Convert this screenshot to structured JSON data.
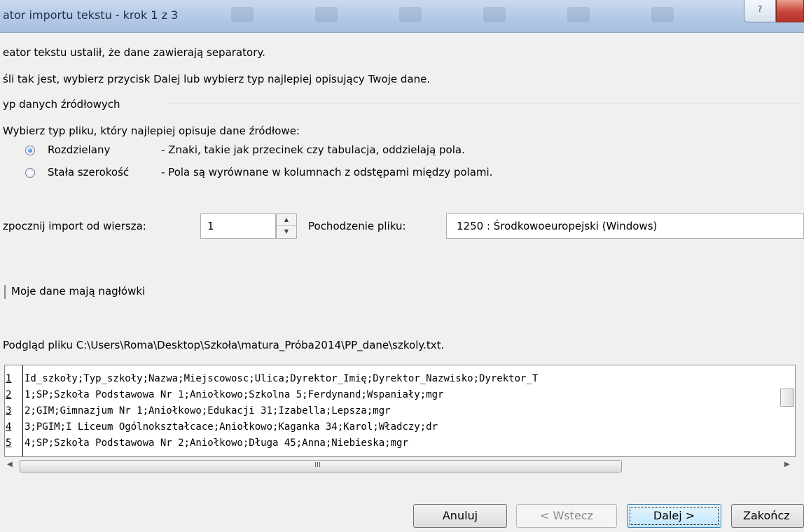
{
  "window": {
    "title": "ator importu tekstu - krok 1 z 3",
    "help_label": "?"
  },
  "intro": {
    "line1": "eator tekstu ustalił, że dane zawierają separatory.",
    "line2": "śli tak jest, wybierz przycisk Dalej lub wybierz typ najlepiej opisujący Twoje dane."
  },
  "group": {
    "title": "yp danych źródłowych",
    "prompt": "Wybierz typ pliku, który najlepiej opisuje dane źródłowe:",
    "options": [
      {
        "label": "Rozdzielany",
        "desc": "- Znaki, takie jak przecinek czy tabulacja, oddzielają pola.",
        "selected": true
      },
      {
        "label": "Stała szerokość",
        "desc": "- Pola są wyrównane w kolumnach z odstępami między polami.",
        "selected": false
      }
    ]
  },
  "import_row": {
    "label": "zpocznij import od wiersza:",
    "start_row": "1",
    "origin_label": "Pochodzenie pliku:",
    "origin_value": "1250 : Środkowoeuropejski (Windows)"
  },
  "headers_checkbox": {
    "label": "Moje dane mają nagłówki",
    "checked": false
  },
  "preview": {
    "caption": "Podgląd pliku C:\\Users\\Roma\\Desktop\\Szkoła\\matura_Próba2014\\PP_dane\\szkoly.txt.",
    "rows": [
      {
        "num": "1",
        "text": "Id_szkoły;Typ_szkoły;Nazwa;Miejscowosc;Ulica;Dyrektor_Imię;Dyrektor_Nazwisko;Dyrektor_T"
      },
      {
        "num": "2",
        "text": "1;SP;Szkoła Podstawowa Nr 1;Aniołkowo;Szkolna 5;Ferdynand;Wspaniały;mgr"
      },
      {
        "num": "3",
        "text": "2;GIM;Gimnazjum Nr 1;Aniołkowo;Edukacji 31;Izabella;Lepsza;mgr"
      },
      {
        "num": "4",
        "text": "3;PGIM;I Liceum Ogólnokształcace;Aniołkowo;Kaganka 34;Karol;Władczy;dr"
      },
      {
        "num": "5",
        "text": "4;SP;Szkoła Podstawowa Nr 2;Aniołkowo;Długa 45;Anna;Niebieska;mgr"
      }
    ],
    "scroll_grip": "III"
  },
  "buttons": {
    "cancel": "Anuluj",
    "back": "< Wstecz",
    "next": "Dalej >",
    "finish": "Zakończ"
  }
}
